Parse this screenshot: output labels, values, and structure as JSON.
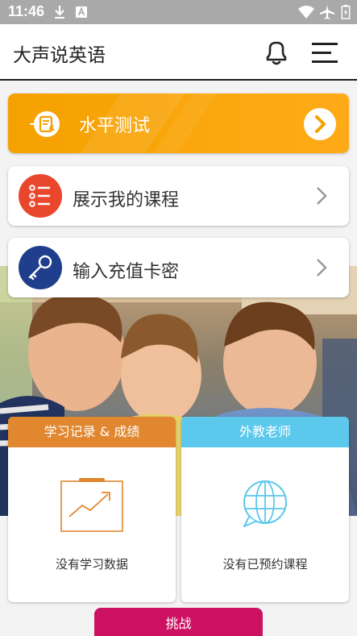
{
  "status_bar": {
    "time": "11:46",
    "icons": [
      "download-icon",
      "a-icon",
      "wifi-icon",
      "airplane-icon",
      "battery-icon"
    ]
  },
  "app_bar": {
    "title": "大声说英语",
    "icons": [
      "bell-icon",
      "menu-icon"
    ]
  },
  "cards": {
    "level_test": {
      "label": "水平测试",
      "icon": "document-icon"
    },
    "my_courses": {
      "label": "展示我的课程",
      "icon": "list-icon"
    },
    "recharge": {
      "label": "输入充值卡密",
      "icon": "key-icon"
    }
  },
  "panels": {
    "records": {
      "header": "学习记录 & 成绩",
      "empty_text": "没有学习数据",
      "icon": "chart-icon"
    },
    "teachers": {
      "header": "外教老师",
      "empty_text": "没有已预约课程",
      "icon": "globe-chat-icon"
    }
  },
  "challenge": {
    "label": "挑战"
  },
  "colors": {
    "accent_orange": "#f7a200",
    "list_red": "#e8472b",
    "key_blue": "#1f3e8c",
    "records_orange": "#e0872f",
    "teachers_blue": "#5bc8ec",
    "challenge_pink": "#cc1162"
  }
}
